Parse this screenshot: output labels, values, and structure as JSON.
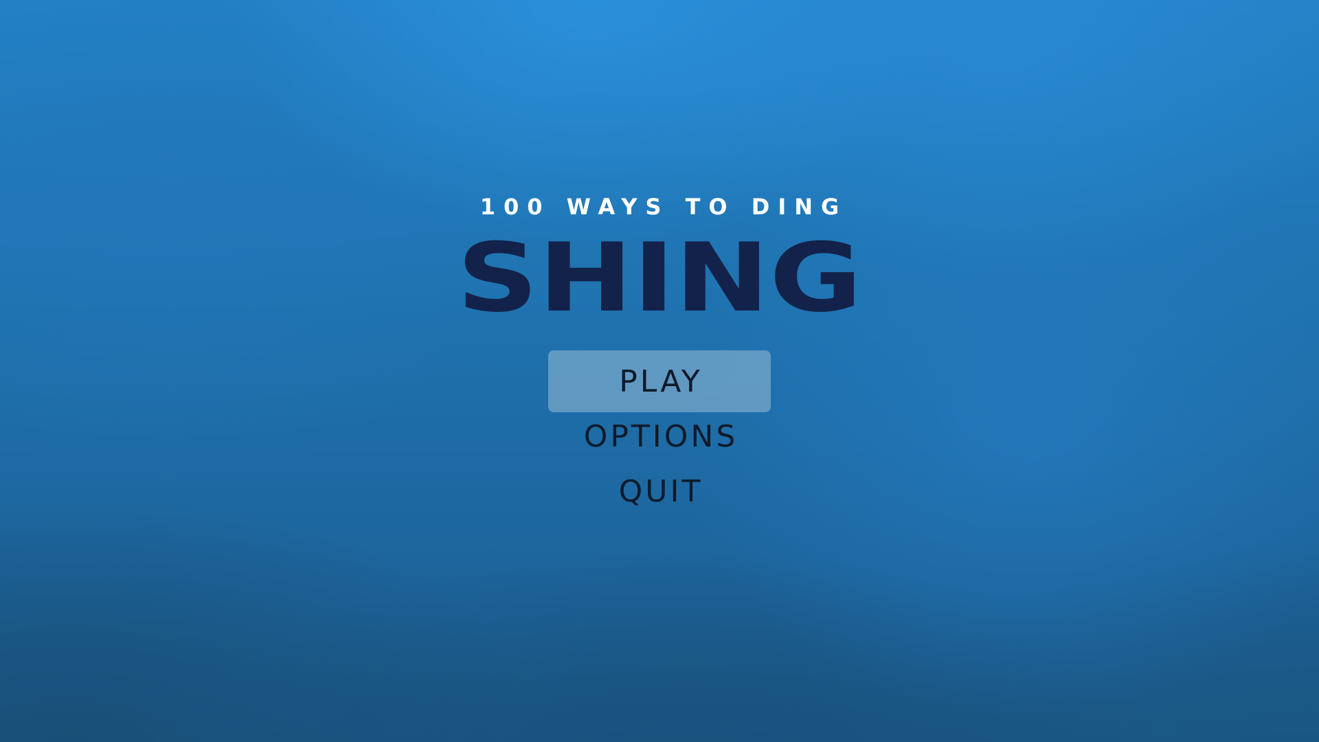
{
  "game": {
    "subtitle": "100 WAYS TO DING",
    "title": "SHING"
  },
  "menu": {
    "items": [
      {
        "label": "PLAY",
        "selected": true
      },
      {
        "label": "OPTIONS",
        "selected": false
      },
      {
        "label": "QUIT",
        "selected": false
      }
    ]
  },
  "colors": {
    "title": "#13224a",
    "subtitle": "#ffffff",
    "menu_text": "#0e1a2a",
    "selected_highlight": "rgba(178,204,222,0.45)",
    "background": "#1f6aa3"
  }
}
